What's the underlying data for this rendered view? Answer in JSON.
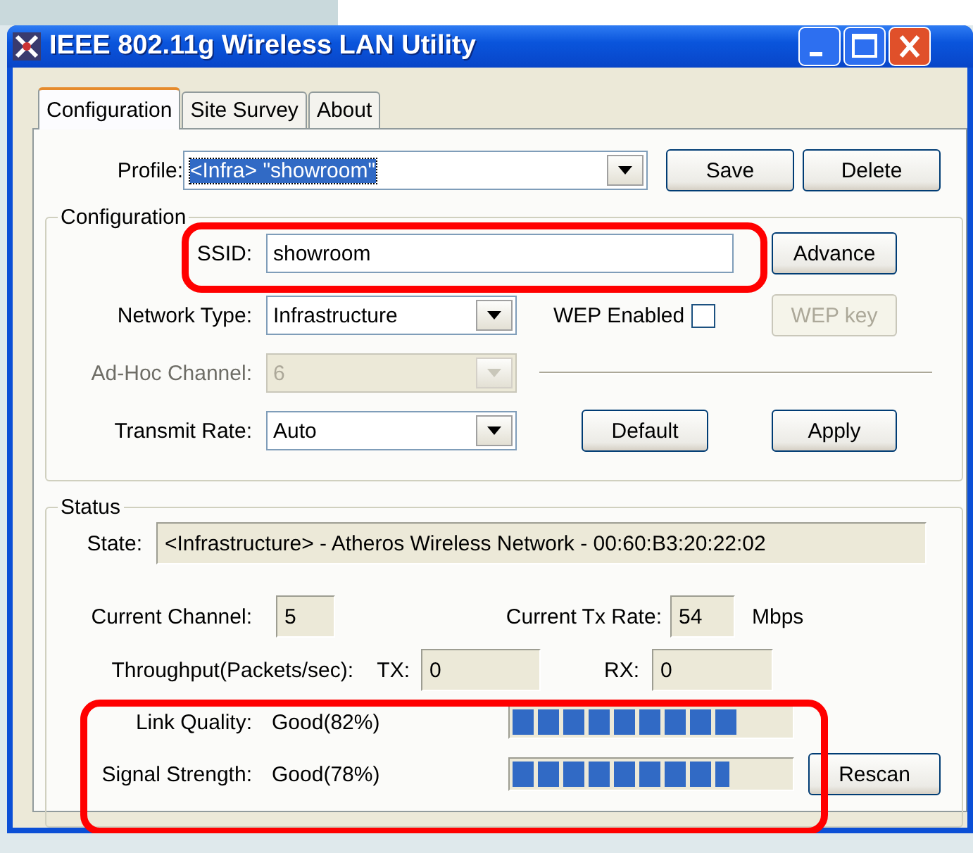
{
  "window": {
    "title": "IEEE 802.11g Wireless LAN Utility"
  },
  "tabs": [
    {
      "label": "Configuration",
      "selected": true
    },
    {
      "label": "Site Survey",
      "selected": false
    },
    {
      "label": "About",
      "selected": false
    }
  ],
  "profile": {
    "label": "Profile:",
    "value": "<Infra> \"showroom\"",
    "text_selected": true
  },
  "profile_buttons": [
    "Save",
    "Delete"
  ],
  "configuration": {
    "title": "Configuration",
    "ssid": {
      "label": "SSID:",
      "value": "showroom",
      "highlighted": true
    },
    "advance_button": "Advance",
    "network_type": {
      "label": "Network Type:",
      "value": "Infrastructure"
    },
    "wep": {
      "label": "WEP Enabled",
      "checked": false
    },
    "wep_key_button": {
      "label": "WEP key",
      "disabled": true
    },
    "adhoc_channel": {
      "label": "Ad-Hoc Channel:",
      "value": "6",
      "disabled": true
    },
    "transmit_rate": {
      "label": "Transmit Rate:",
      "value": "Auto"
    },
    "buttons": [
      "Default",
      "Apply"
    ]
  },
  "status": {
    "title": "Status",
    "state": {
      "label": "State:",
      "value": "<Infrastructure> - Atheros Wireless Network - 00:60:B3:20:22:02"
    },
    "current_channel": {
      "label": "Current Channel:",
      "value": "5"
    },
    "tx_rate": {
      "label": "Current Tx Rate:",
      "value": "54",
      "unit": "Mbps"
    },
    "throughput": {
      "label": "Throughput(Packets/sec):",
      "tx_label": "TX:",
      "tx": "0",
      "rx_label": "RX:",
      "rx": "0"
    },
    "meters": {
      "highlighted": true,
      "items": [
        {
          "label": "Link Quality:",
          "reading": "Good(82%)",
          "level": 0.82
        },
        {
          "label": "Signal Strength:",
          "reading": "Good(78%)",
          "level": 0.78
        }
      ]
    },
    "rescan_button": "Rescan"
  }
}
